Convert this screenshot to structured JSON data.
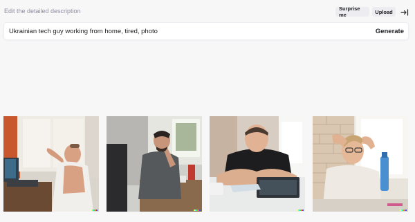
{
  "header": {
    "hint_text": "Edit the detailed description",
    "surprise_label": "Surprise me",
    "upload_label": "Upload",
    "collapse_icon": "arrow-right-to-line-icon"
  },
  "prompt": {
    "value": "Ukrainian tech guy working from home, tired, photo",
    "generate_label": "Generate"
  },
  "images": [
    {
      "name": "generated-image-1",
      "subject": "man in tank top slumped at desk by window"
    },
    {
      "name": "generated-image-2",
      "subject": "bearded man in grey shirt resting head on hand at desk"
    },
    {
      "name": "generated-image-3",
      "subject": "man in black t-shirt with arms crossed on desk at laptop"
    },
    {
      "name": "generated-image-4",
      "subject": "man with glasses holding head at desk near window"
    }
  ],
  "colors": {
    "background": "#f7f7f8",
    "button_bg": "#ececf1",
    "hint_text": "#8e8ea0",
    "watermark": [
      "#ffff66",
      "#42ffff",
      "#51da4c",
      "#ff6e3c",
      "#3c46ff"
    ]
  }
}
